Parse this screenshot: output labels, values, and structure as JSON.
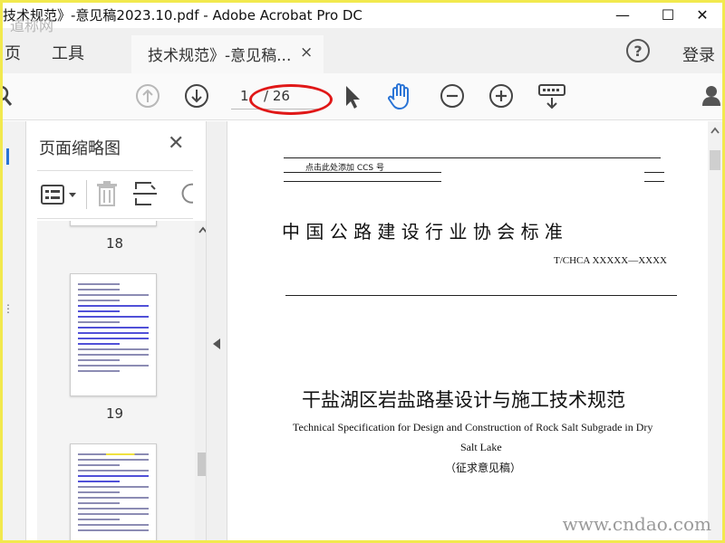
{
  "window": {
    "title": "技术规范》-意见稿2023.10.pdf - Adobe Acrobat Pro DC",
    "minimize_glyph": "—",
    "maximize_glyph": "☐",
    "close_glyph": "✕"
  },
  "menu_tabs": {
    "home": "页",
    "tools": "工具",
    "document_tab": "技术规范》-意见稿...",
    "document_tab_close": "×",
    "login": "登录"
  },
  "toolbar": {
    "current_page": "1",
    "total_pages": "/ 26",
    "icons": [
      "search-icon",
      "page-up-icon",
      "page-down-icon",
      "select-arrow-icon",
      "hand-icon",
      "zoom-out-icon",
      "zoom-in-icon",
      "keyboard-icon",
      "share-user-icon"
    ],
    "accent_color": "#2a74d6",
    "annotation_color": "#e01818"
  },
  "thumbnail_panel": {
    "title": "页面缩略图",
    "close": "✕",
    "page_labels": [
      "18",
      "19"
    ]
  },
  "document": {
    "ccs_placeholder": "点击此处添加 CCS 号",
    "association": "中 国 公 路 建 设 行 业 协 会 标 准",
    "standard_code": "T/CHCA XXXXX—XXXX",
    "title_cn": "干盐湖区岩盐路基设计与施工技术规范",
    "title_en_line1": "Technical Specification for Design and Construction of Rock Salt Subgrade in Dry",
    "title_en_line2": "Salt Lake",
    "draft_label": "（征求意见稿）"
  },
  "watermark": {
    "bottom_right": "www.cndao.com",
    "top_left": "道称网"
  }
}
